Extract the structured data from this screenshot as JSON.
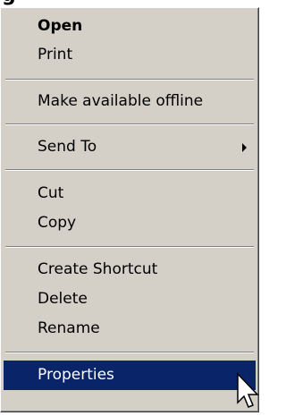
{
  "partial_text": "g",
  "menu": {
    "items": [
      {
        "label": "Open",
        "default": true
      },
      {
        "label": "Print"
      },
      {
        "label": "Make available offline"
      },
      {
        "label": "Send To",
        "submenu": true
      },
      {
        "label": "Cut"
      },
      {
        "label": "Copy"
      },
      {
        "label": "Create Shortcut"
      },
      {
        "label": "Delete"
      },
      {
        "label": "Rename"
      },
      {
        "label": "Properties",
        "selected": true
      }
    ]
  },
  "colors": {
    "menu_background": "#d4d0c8",
    "highlight": "#0a246a",
    "highlight_text": "#ffffff"
  },
  "icons": {
    "submenu_arrow": "chevron-right-icon",
    "pointer": "mouse-pointer-icon"
  }
}
